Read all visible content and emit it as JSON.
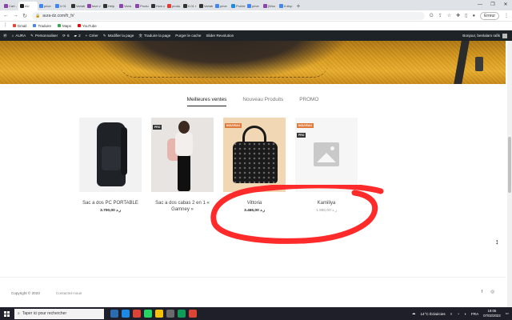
{
  "browser": {
    "tabs": [
      {
        "label": "Cart -",
        "color": "#8e44ad"
      },
      {
        "label": "AU",
        "color": "#222222",
        "active": true
      },
      {
        "label": "price",
        "color": "#4285f4"
      },
      {
        "label": "0.01",
        "color": "#4285f4"
      },
      {
        "label": "Variab",
        "color": "#333333"
      },
      {
        "label": "fave v",
        "color": "#8e44ad"
      },
      {
        "label": "Help",
        "color": "#333333"
      },
      {
        "label": "Varia",
        "color": "#8e44ad"
      },
      {
        "label": "Produ",
        "color": "#8e44ad"
      },
      {
        "label": "How c",
        "color": "#333333"
      },
      {
        "label": "produ",
        "color": "#e53935"
      },
      {
        "label": "0.01 r",
        "color": "#333333"
      },
      {
        "label": "Variab",
        "color": "#333333"
      },
      {
        "label": "price",
        "color": "#4285f4"
      },
      {
        "label": "Proble",
        "color": "#1e88e5"
      },
      {
        "label": "price",
        "color": "#4285f4"
      },
      {
        "label": "[Woo",
        "color": "#8e44ad"
      },
      {
        "label": "it disp",
        "color": "#4285f4"
      }
    ],
    "new_tab": "+",
    "url": "aura-dz.com/fr_fr/",
    "error_button": "Erreur",
    "bookmarks": [
      {
        "label": "Gmail",
        "color": "#ea4335"
      },
      {
        "label": "Traduire",
        "color": "#4285f4"
      },
      {
        "label": "Maps",
        "color": "#34a853"
      },
      {
        "label": "YouTube",
        "color": "#ff0000"
      }
    ]
  },
  "wp_admin": {
    "site": "AURA",
    "customize": "Personnaliser",
    "updates": "6",
    "comments": "2",
    "new": "Créer",
    "edit_page": "Modifier la page",
    "translate": "Traduire la page",
    "purge_cache": "Purger le cache",
    "slider": "Slider Revolution",
    "greeting": "Bonjour, benlalam rafik"
  },
  "page": {
    "tabs": [
      "Meilleures ventes",
      "Nouveau Produits",
      "PROMO"
    ],
    "active_tab": "Meilleures ventes",
    "products": [
      {
        "name": "Sac a dos PC PORTABLE",
        "price": "3.700,00 ر.د",
        "badges": []
      },
      {
        "name": "Sac a dos cabas 2 en 1 « Gamney »",
        "price": "",
        "badges": [
          {
            "text": "PRO",
            "type": "promo"
          }
        ]
      },
      {
        "name": "Vittoria",
        "price": "3.465,00 ر.د",
        "badges": [
          {
            "text": "NOUVEAU",
            "type": "new"
          }
        ]
      },
      {
        "name": "Kamiliya",
        "price": "1.980,00 ر.د",
        "badges": [
          {
            "text": "NOUVEAU",
            "type": "new"
          },
          {
            "text": "PRO",
            "type": "promo"
          }
        ]
      }
    ],
    "footer": {
      "copyright": "Copyright © 2023",
      "contact": "Contactez-nous",
      "facebook": "f",
      "instagram": "◎"
    }
  },
  "taskbar": {
    "search_placeholder": "Taper ici pour rechercher",
    "weather": "14°C  Éclaircies",
    "language": "FRA",
    "time": "19:05",
    "date": "07/02/2023"
  },
  "colors": {
    "wp_bar": "#1d2327",
    "annotation_red": "#ff2a2a"
  }
}
